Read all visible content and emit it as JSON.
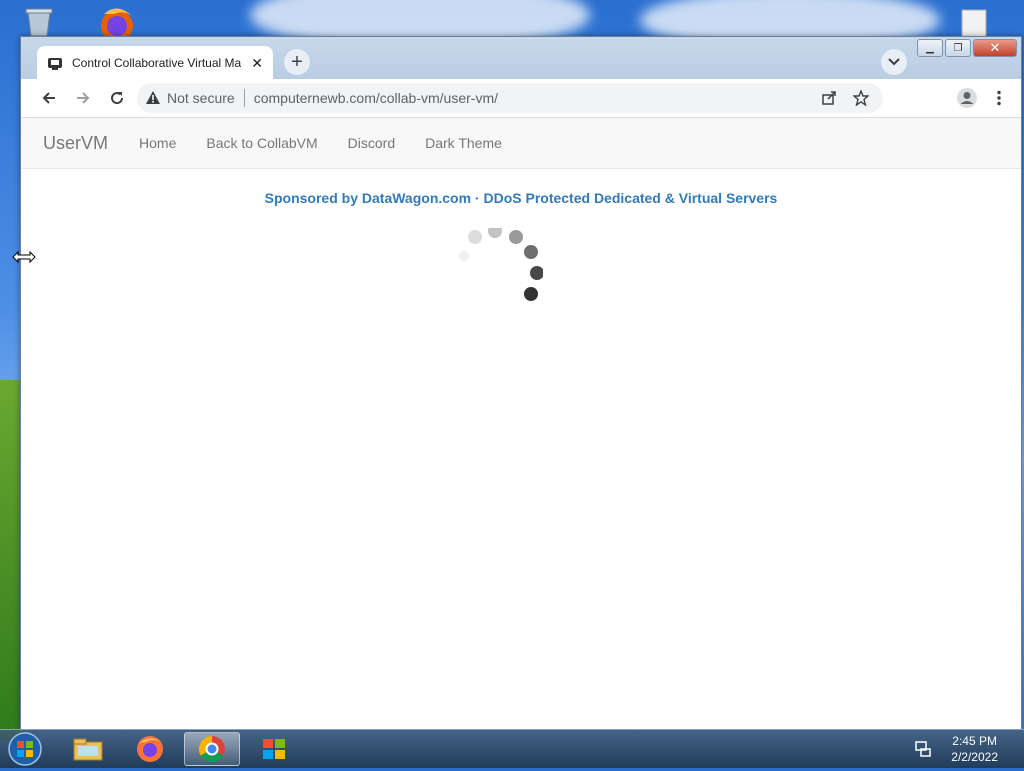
{
  "browser": {
    "tab": {
      "title": "Control Collaborative Virtual Machines",
      "close_icon": "close-icon"
    },
    "address": {
      "security_label": "Not secure",
      "url": "computernewb.com/collab-vm/user-vm/"
    }
  },
  "page": {
    "navbar": {
      "brand": "UserVM",
      "links": [
        "Home",
        "Back to CollabVM",
        "Discord",
        "Dark Theme"
      ]
    },
    "sponsor_text": "Sponsored by DataWagon.com · DDoS Protected Dedicated & Virtual Servers"
  },
  "taskbar": {
    "clock_time": "2:45 PM",
    "clock_date": "2/2/2022",
    "apps": [
      "file-explorer-icon",
      "firefox-icon",
      "chrome-icon",
      "windows-media-icon"
    ]
  },
  "colors": {
    "link": "#337ab7",
    "nav_text": "#777777",
    "close_button": "#c4402a"
  }
}
